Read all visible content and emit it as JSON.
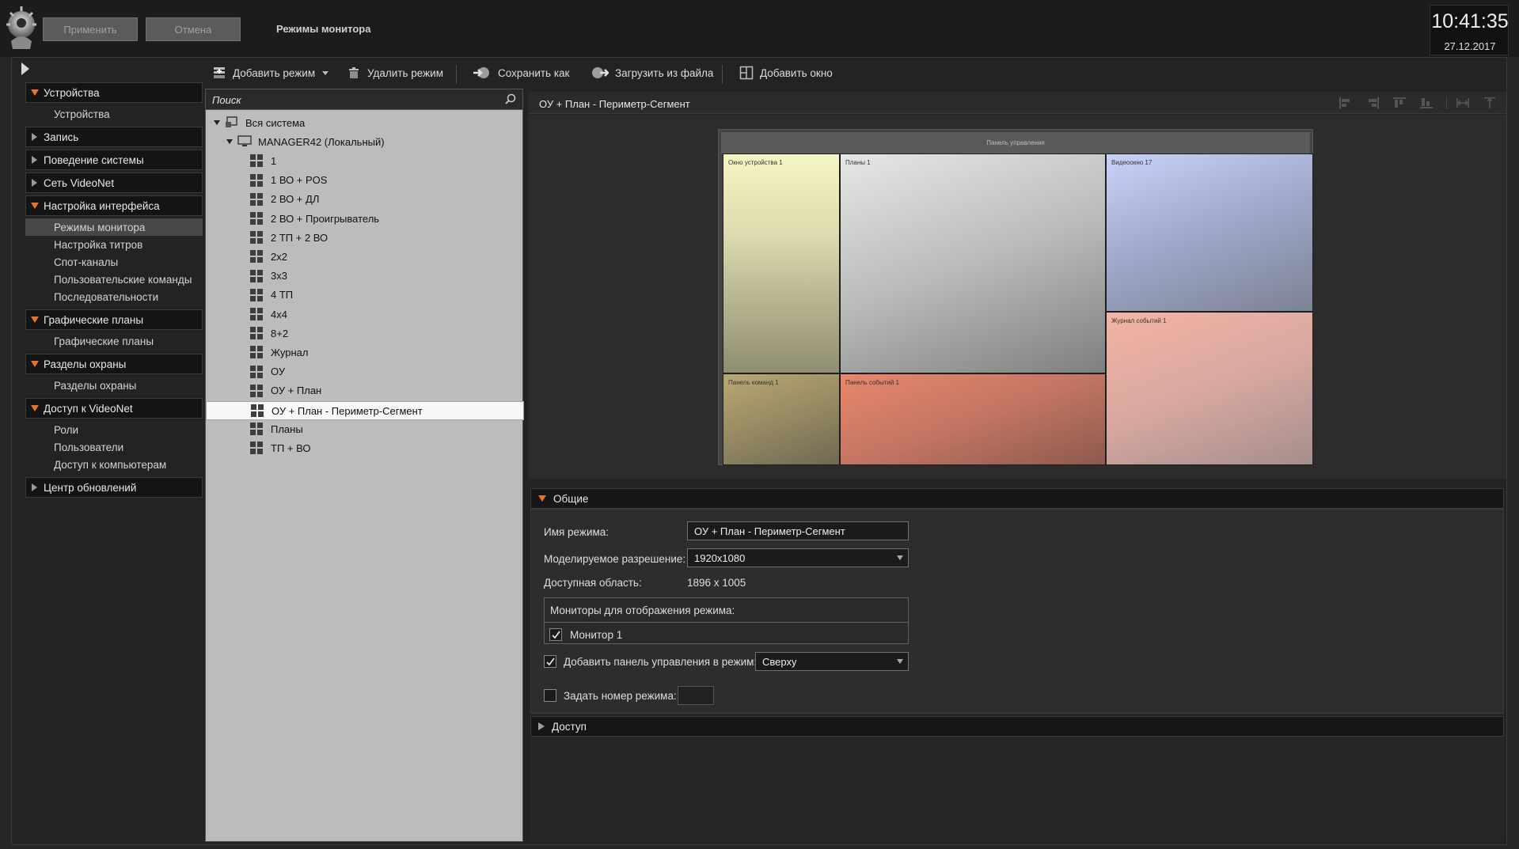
{
  "header": {
    "apply_label": "Применить",
    "cancel_label": "Отмена",
    "title": "Режимы монитора",
    "time": "10:41:35",
    "date": "27.12.2017"
  },
  "toolbar": {
    "add_mode": "Добавить режим",
    "delete_mode": "Удалить режим",
    "save_as": "Сохранить как",
    "load_from_file": "Загрузить из файла",
    "add_window": "Добавить окно"
  },
  "nav": [
    {
      "title": "Устройства",
      "expanded": true,
      "items": [
        "Устройства"
      ]
    },
    {
      "title": "Запись",
      "expanded": false,
      "items": []
    },
    {
      "title": "Поведение системы",
      "expanded": false,
      "items": []
    },
    {
      "title": "Сеть VideoNet",
      "expanded": false,
      "items": []
    },
    {
      "title": "Настройка интерфейса",
      "expanded": true,
      "items": [
        "Режимы монитора",
        "Настройка титров",
        "Спот-каналы",
        "Пользовательские команды",
        "Последовательности"
      ],
      "selected": 0
    },
    {
      "title": "Графические планы",
      "expanded": true,
      "items": [
        "Графические планы"
      ]
    },
    {
      "title": "Разделы охраны",
      "expanded": true,
      "items": [
        "Разделы охраны"
      ]
    },
    {
      "title": "Доступ к VideoNet",
      "expanded": true,
      "items": [
        "Роли",
        "Пользователи",
        "Доступ к компьютерам"
      ]
    },
    {
      "title": "Центр обновлений",
      "expanded": false,
      "items": []
    }
  ],
  "tree": {
    "search_placeholder": "Поиск",
    "root": "Вся система",
    "server": "MANAGER42 (Локальный)",
    "modes": [
      "1",
      "1 ВО + POS",
      "2 ВО + ДЛ",
      "2 ВО + Проигрыватель",
      "2 ТП + 2 ВО",
      "2x2",
      "3x3",
      "4 ТП",
      "4x4",
      "8+2",
      "Журнал",
      "ОУ",
      "ОУ + План",
      "ОУ + План - Периметр-Сегмент",
      "Планы",
      "ТП + ВО"
    ],
    "selected_index": 13
  },
  "preview": {
    "title": "ОУ + План - Периметр-Сегмент",
    "control_panel": "Панель управления",
    "windows": {
      "devices": "Окно устройства 1",
      "plans": "Планы 1",
      "video": "Видеоокно 17",
      "journal": "Журнал событий 1",
      "commands": "Панель команд 1",
      "events": "Панель событий 1"
    }
  },
  "general": {
    "section_title": "Общие",
    "name_label": "Имя режима:",
    "name_value": "ОУ + План - Периметр-Сегмент",
    "resolution_label": "Моделируемое разрешение:",
    "resolution_value": "1920x1080",
    "area_label": "Доступная область:",
    "area_value": "1896 x 1005",
    "monitors_header": "Мониторы для отображения режима:",
    "monitor_item": "Монитор 1",
    "monitor_checked": true,
    "add_panel_label": "Добавить панель управления в режим:",
    "add_panel_checked": true,
    "panel_position": "Сверху",
    "set_number_label": "Задать номер режима:",
    "set_number_checked": false,
    "number_value": ""
  },
  "access": {
    "section_title": "Доступ"
  },
  "colors": {
    "accent": "#e8742a",
    "background": "#262626",
    "tree_bg": "#bcbcbc"
  }
}
